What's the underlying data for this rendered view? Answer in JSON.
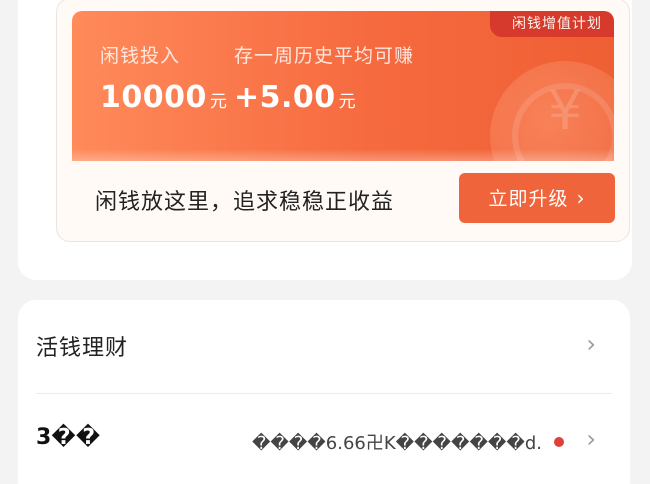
{
  "promo": {
    "badge": "闲钱增值计划",
    "invest_label": "闲钱投入",
    "invest_value": "10000",
    "invest_unit": "元",
    "earn_label": "存一周历史平均可赚",
    "earn_value": "+5.00",
    "earn_unit": "元",
    "slogan": "闲钱放这里，追求稳稳正收益",
    "upgrade_button": "立即升级",
    "upgrade_chevron": "›",
    "coin_glyph": "¥"
  },
  "list": {
    "items": [
      {
        "title": "活钱理财",
        "chevron": "›"
      },
      {
        "title": "3��",
        "value": "����6.66卍K�������d.",
        "chevron": "›"
      }
    ]
  },
  "colors": {
    "banner_orange": "#f66a3f",
    "button_orange": "#f0643b",
    "badge_red": "#d63a2c",
    "status_dot": "#e0403a"
  }
}
